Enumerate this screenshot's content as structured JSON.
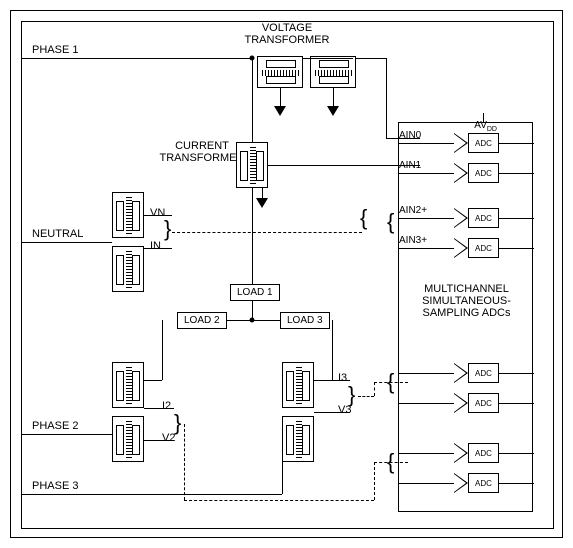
{
  "title_top": "VOLTAGE\nTRANSFORMER",
  "current_t": "CURRENT\nTRANSFORMER",
  "adc_title": "MULTICHANNEL\nSIMULTANEOUS-\nSAMPLING ADCs",
  "avdd": "AVDD",
  "phases": {
    "p1": "PHASE 1",
    "p2": "PHASE 2",
    "p3": "PHASE 3",
    "neutral": "NEUTRAL"
  },
  "pins": {
    "ain0": "AIN0",
    "ain1": "AIN1",
    "ain2": "AIN2+",
    "ain3": "AIN3+"
  },
  "loads": {
    "l1": "LOAD 1",
    "l2": "LOAD 2",
    "l3": "LOAD 3"
  },
  "sigs": {
    "vn": "VN",
    "in": "IN",
    "i2": "I2",
    "v2": "V2",
    "i3": "I3",
    "v3": "V3"
  },
  "adc_label": "ADC"
}
